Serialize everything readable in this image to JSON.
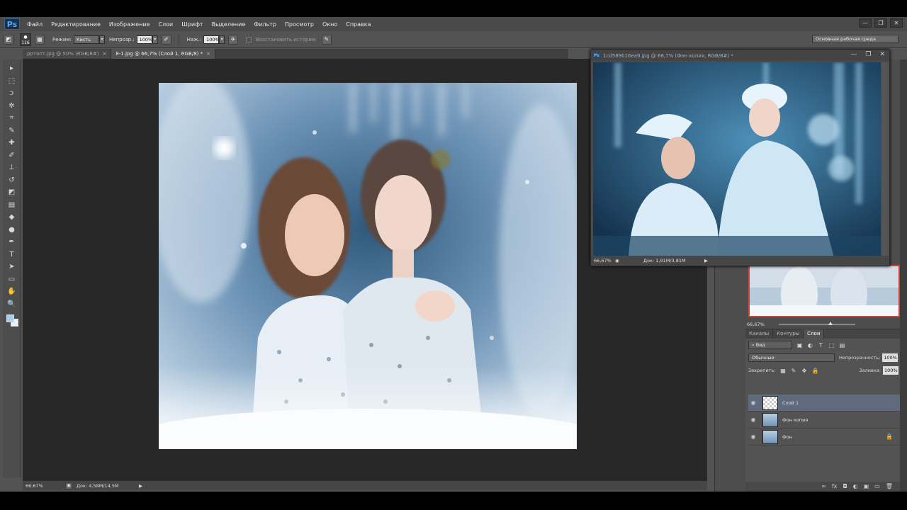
{
  "app": {
    "logo": "Ps"
  },
  "menu": {
    "items": [
      "Файл",
      "Редактирование",
      "Изображение",
      "Слои",
      "Шрифт",
      "Выделение",
      "Фильтр",
      "Просмотр",
      "Окно",
      "Справка"
    ]
  },
  "window_controls": {
    "minimize": "—",
    "restore": "❐",
    "close": "✕"
  },
  "options": {
    "brush_size": "116",
    "mode_label": "Режим:",
    "mode_value": "Кисть",
    "opacity_label": "Непрозр.:",
    "opacity_value": "100%",
    "pressure_label": "Наж.:",
    "pressure_value": "100%",
    "restore_history": "Восстановить историю",
    "workspace": "Основная рабочая среда"
  },
  "tabs": [
    {
      "label": "рртапт.jpg @ 50% (RGB/8#)",
      "close": "×",
      "active": false
    },
    {
      "label": "8-1.jpg @ 66,7% (Слой 1, RGB/8) *",
      "close": "×",
      "active": true
    }
  ],
  "tools": {
    "icons": [
      "move-icon",
      "marquee-icon",
      "lasso-icon",
      "quick-select-icon",
      "crop-icon",
      "eyedropper-icon",
      "healing-icon",
      "brush-icon",
      "clone-stamp-icon",
      "history-brush-icon",
      "eraser-icon",
      "gradient-icon",
      "blur-icon",
      "dodge-icon",
      "pen-icon",
      "type-icon",
      "path-select-icon",
      "shape-icon",
      "hand-icon",
      "zoom-icon"
    ],
    "glyphs": [
      "▸",
      "⬚",
      "ↄ",
      "✲",
      "⌗",
      "✎",
      "✚",
      "✐",
      "⊥",
      "↺",
      "◩",
      "▤",
      "◆",
      "●",
      "✒",
      "T",
      "➤",
      "▭",
      "✋",
      "🔍"
    ]
  },
  "status": {
    "zoom": "66,67%",
    "doc": "Док: 4,58M/14,5M",
    "arrow": "▶"
  },
  "float_window": {
    "title": "1cd589b16ea9.jpg @ 66,7% (Фон копия, RGB/8#) *",
    "zoom": "66,67%",
    "doc": "Док: 1,91M/3,81M",
    "arrow": "▶"
  },
  "navigator": {
    "zoom": "66,67%"
  },
  "layers_panel": {
    "tabs": [
      "Каналы",
      "Контуры",
      "Слои"
    ],
    "filter": "Вид",
    "blend": "Обычные",
    "opacity_label": "Непрозрачность:",
    "opacity": "100%",
    "lock_label": "Закрепить:",
    "fill_label": "Заливка:",
    "fill": "100%",
    "layers": [
      {
        "name": "Слой 1",
        "active": true,
        "locked": false
      },
      {
        "name": "Фон копия",
        "active": false,
        "locked": false
      },
      {
        "name": "Фон",
        "active": false,
        "locked": true
      }
    ],
    "footer_icons": [
      "∞",
      "fx",
      "◘",
      "◐",
      "▣",
      "▭",
      "🗑"
    ]
  },
  "colors": {
    "foreground": "#a8cde8",
    "background": "#e6f3fb"
  }
}
